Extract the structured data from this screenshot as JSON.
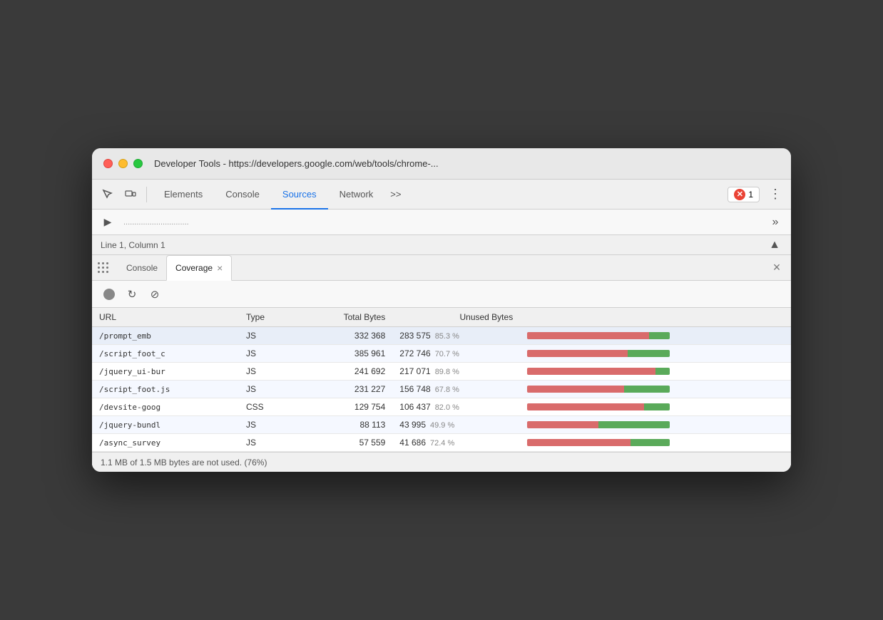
{
  "window": {
    "title": "Developer Tools - https://developers.google.com/web/tools/chrome-..."
  },
  "tabs": [
    {
      "label": "Elements",
      "active": false
    },
    {
      "label": "Console",
      "active": false
    },
    {
      "label": "Sources",
      "active": true
    },
    {
      "label": "Network",
      "active": false
    }
  ],
  "more_tabs": ">>",
  "error_badge": {
    "count": "1"
  },
  "status_bar": {
    "position": "Line 1, Column 1"
  },
  "drawer": {
    "tabs": [
      {
        "label": "Console",
        "active": false,
        "closable": false
      },
      {
        "label": "Coverage",
        "active": true,
        "closable": true
      }
    ]
  },
  "coverage": {
    "table": {
      "headers": [
        "URL",
        "Type",
        "Total Bytes",
        "Unused Bytes",
        ""
      ],
      "rows": [
        {
          "url": "/prompt_emb",
          "type": "JS",
          "total_bytes": "332 368",
          "unused_bytes": "283 575",
          "pct": "85.3 %",
          "red_pct": 85.3,
          "green_pct": 14.7
        },
        {
          "url": "/script_foot_c",
          "type": "JS",
          "total_bytes": "385 961",
          "unused_bytes": "272 746",
          "pct": "70.7 %",
          "red_pct": 70.7,
          "green_pct": 29.3
        },
        {
          "url": "/jquery_ui-bur",
          "type": "JS",
          "total_bytes": "241 692",
          "unused_bytes": "217 071",
          "pct": "89.8 %",
          "red_pct": 89.8,
          "green_pct": 10.2
        },
        {
          "url": "/script_foot.js",
          "type": "JS",
          "total_bytes": "231 227",
          "unused_bytes": "156 748",
          "pct": "67.8 %",
          "red_pct": 67.8,
          "green_pct": 32.2
        },
        {
          "url": "/devsite-goog",
          "type": "CSS",
          "total_bytes": "129 754",
          "unused_bytes": "106 437",
          "pct": "82.0 %",
          "red_pct": 82.0,
          "green_pct": 18.0
        },
        {
          "url": "/jquery-bundl",
          "type": "JS",
          "total_bytes": "88 113",
          "unused_bytes": "43 995",
          "pct": "49.9 %",
          "red_pct": 49.9,
          "green_pct": 50.1
        },
        {
          "url": "/async_survey",
          "type": "JS",
          "total_bytes": "57 559",
          "unused_bytes": "41 686",
          "pct": "72.4 %",
          "red_pct": 72.4,
          "green_pct": 27.6
        }
      ]
    },
    "footer": "1.1 MB of 1.5 MB bytes are not used. (76%)"
  }
}
